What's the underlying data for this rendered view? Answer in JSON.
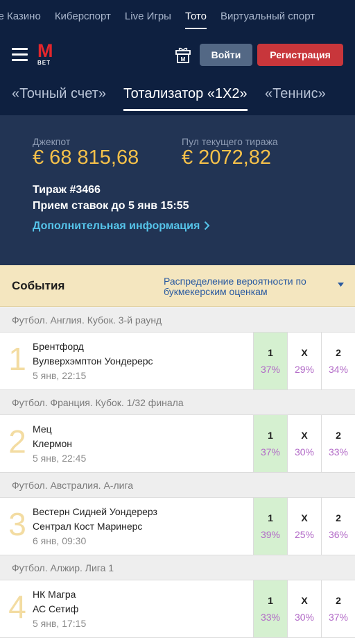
{
  "topnav": {
    "items": [
      "ve Казино",
      "Киберспорт",
      "Live Игры",
      "Тото",
      "Виртуальный спорт"
    ]
  },
  "header": {
    "logo_m": "M",
    "logo_bet": "BET",
    "login": "Войти",
    "register": "Регистрация"
  },
  "tabs": [
    "«Точный счет»",
    "Тотализатор «1Х2»",
    "«Теннис»"
  ],
  "jackpot": {
    "label": "Джекпот",
    "value": "€ 68 815,68",
    "pool_label": "Пул текущего тиража",
    "pool_value": "€ 2072,82",
    "draw": "Тираж #3466",
    "accept": "Прием ставок до 5 янв 15:55",
    "more_info": "Дополнительная информация"
  },
  "events_header": {
    "title": "События",
    "distribution": "Распределение вероятности по букмекерским оценкам"
  },
  "odds_labels": [
    "1",
    "X",
    "2"
  ],
  "events": [
    {
      "league": "Футбол. Англия. Кубок. 3-й раунд",
      "num": "1",
      "team1": "Брентфорд",
      "team2": "Вулверхэмптон Уондерерс",
      "time": "5 янв, 22:15",
      "p1": "37%",
      "px": "29%",
      "p2": "34%"
    },
    {
      "league": "Футбол. Франция. Кубок. 1/32 финала",
      "num": "2",
      "team1": "Мец",
      "team2": "Клермон",
      "time": "5 янв, 22:45",
      "p1": "37%",
      "px": "30%",
      "p2": "33%"
    },
    {
      "league": "Футбол. Австралия. А-лига",
      "num": "3",
      "team1": "Вестерн Сидней Уондерерз",
      "team2": "Сентрал Кост Маринерс",
      "time": "6 янв, 09:30",
      "p1": "39%",
      "px": "25%",
      "p2": "36%"
    },
    {
      "league": "Футбол. Алжир. Лига 1",
      "num": "4",
      "team1": "НК Магра",
      "team2": "АС Сетиф",
      "time": "5 янв, 17:15",
      "p1": "33%",
      "px": "30%",
      "p2": "37%"
    }
  ]
}
